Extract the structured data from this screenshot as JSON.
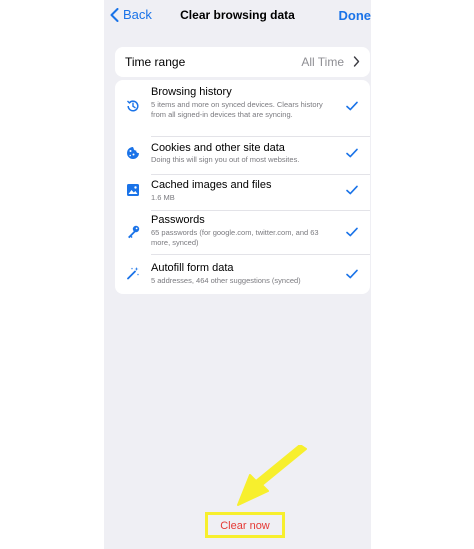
{
  "nav": {
    "back_label": "Back",
    "title": "Clear browsing data",
    "done_label": "Done"
  },
  "time_range": {
    "label": "Time range",
    "value": "All Time"
  },
  "items": [
    {
      "icon": "history-icon",
      "label": "Browsing history",
      "description": "5 items and more on synced devices. Clears history from all signed-in devices that are syncing.",
      "checked": true
    },
    {
      "icon": "cookie-icon",
      "label": "Cookies and other site data",
      "description": "Doing this will sign you out of most websites.",
      "checked": true
    },
    {
      "icon": "image-icon",
      "label": "Cached images and files",
      "description": "1.6 MB",
      "checked": true
    },
    {
      "icon": "key-icon",
      "label": "Passwords",
      "description": "65 passwords (for google.com, twitter.com, and 63 more, synced)",
      "checked": true
    },
    {
      "icon": "magic-wand-icon",
      "label": "Autofill form data",
      "description": "5 addresses, 464 other suggestions (synced)",
      "checked": true
    }
  ],
  "clear_button": {
    "label": "Clear now"
  },
  "colors": {
    "accent": "#1a73e8",
    "destructive": "#e53935",
    "highlight": "#f7ef2d",
    "background": "#efeff4"
  }
}
